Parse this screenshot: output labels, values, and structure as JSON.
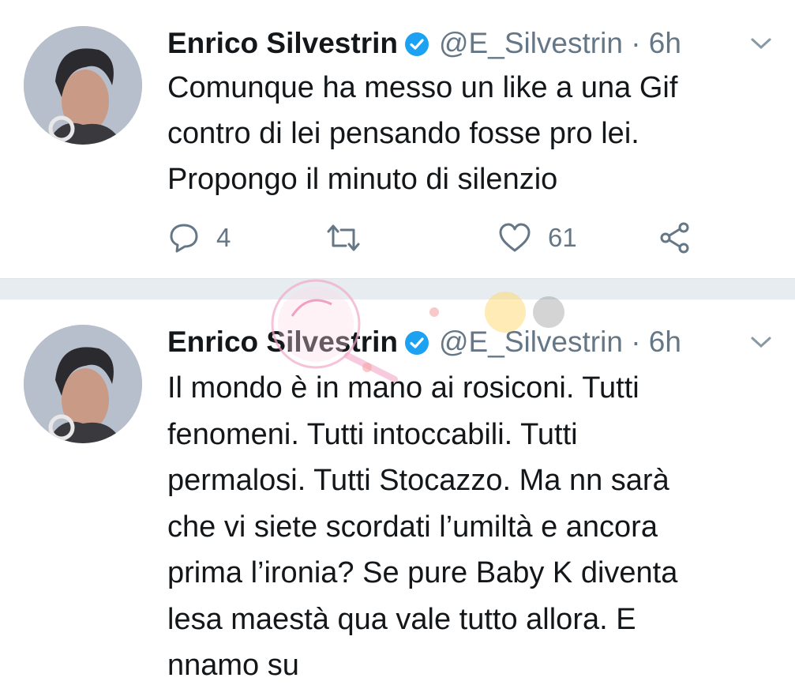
{
  "tweets": [
    {
      "author_name": "Enrico Silvestrin",
      "handle_time": "@E_Silvestrin · 6h",
      "text": "Comunque ha messo un like a una Gif\ncontro di lei pensando fosse pro lei.\nPropongo il minuto di silenzio",
      "actions": {
        "replies": "4",
        "retweets": "",
        "likes": "61"
      }
    },
    {
      "author_name": "Enrico Silvestrin",
      "handle_time": "@E_Silvestrin · 6h",
      "text": "Il mondo è in mano ai rosiconi. Tutti\nfenomeni. Tutti intoccabili. Tutti\npermalosi. Tutti Stocazzo. Ma nn sarà\nche vi siete scordati l’umiltà e ancora\nprima l’ironia? Se pure Baby K diventa\nlesa maestà qua vale tutto allora. E\nnnamo su"
    }
  ],
  "icons": {
    "verified": "verified-badge-icon",
    "caret": "chevron-down-icon",
    "reply": "reply-icon",
    "retweet": "retweet-icon",
    "like": "heart-icon",
    "share": "share-icon"
  },
  "colors": {
    "verified_blue": "#1da1f2",
    "secondary_text": "#657786",
    "primary_text": "#14171a",
    "divider": "#e6ecf0"
  }
}
